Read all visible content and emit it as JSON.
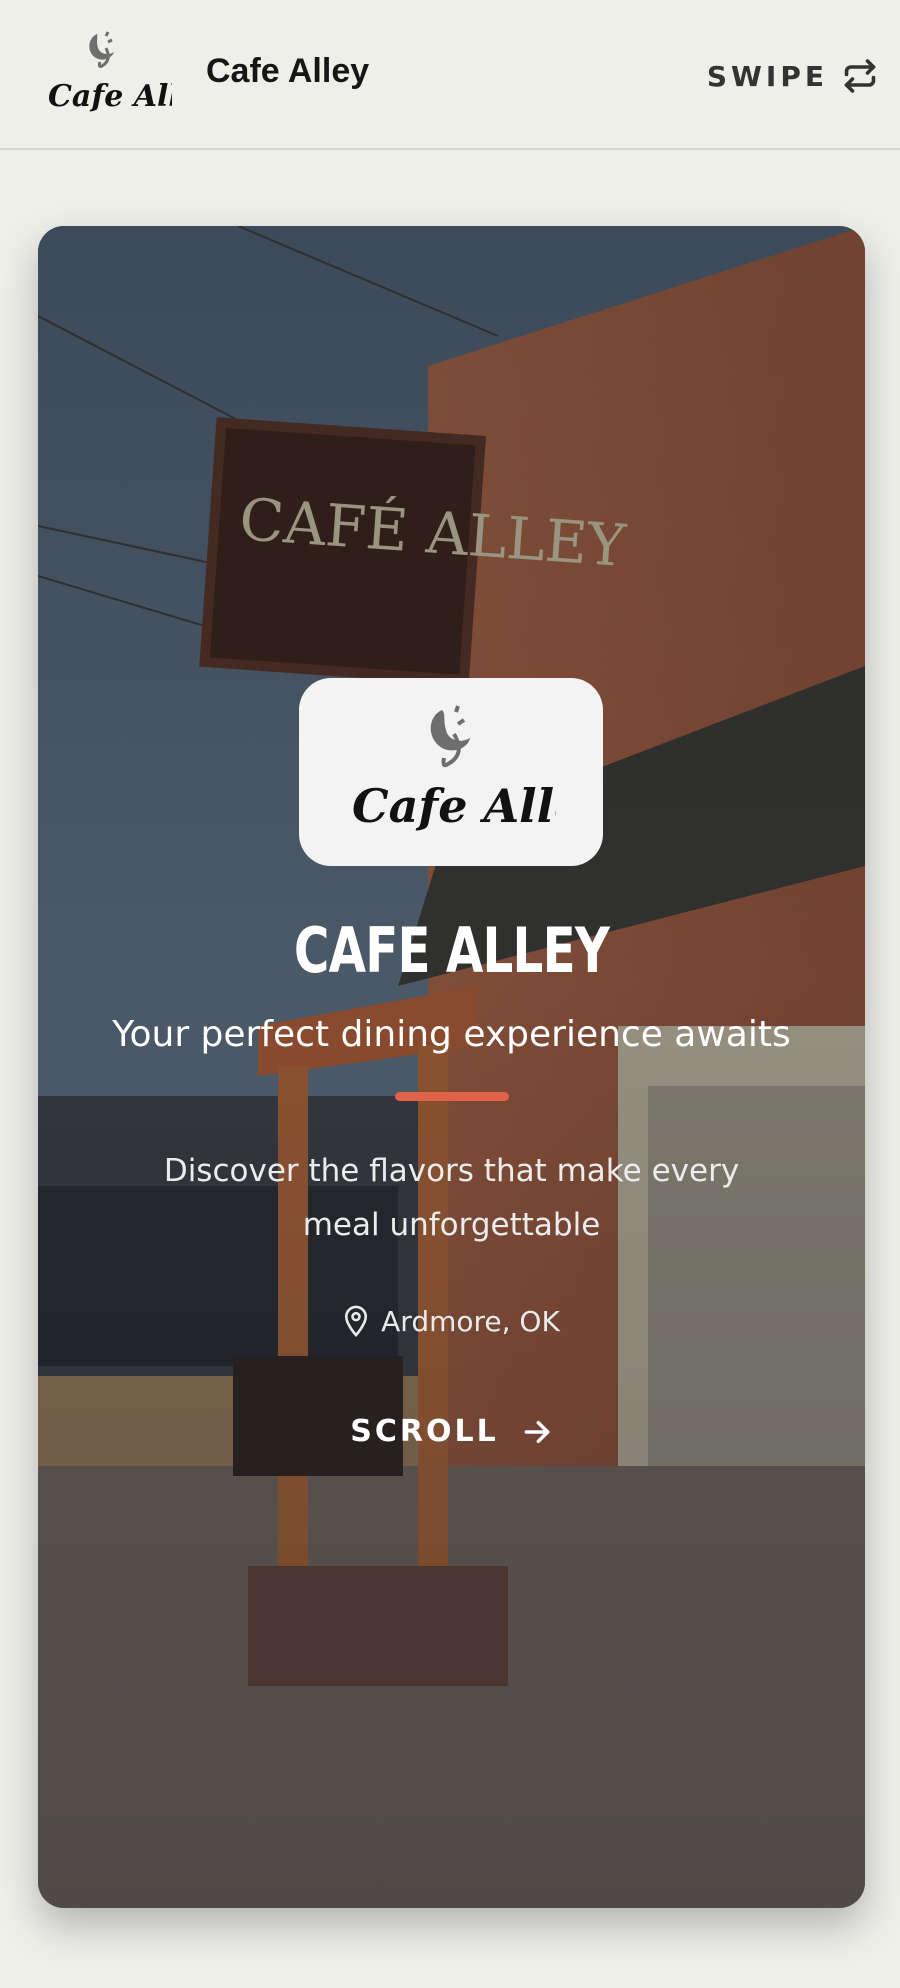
{
  "header": {
    "logo_alt": "Cafe Alley",
    "title": "Cafe Alley",
    "swipe_label": "SWIPE",
    "swipe_icon": "repeat-arrows-icon"
  },
  "hero": {
    "logo_icon": "cafe-alley-logo",
    "title": "CAFE ALLEY",
    "tagline": "Your perfect dining experience awaits",
    "description": "Discover the flavors that make every meal unforgettable",
    "location_icon": "map-pin-icon",
    "location": "Ardmore, OK",
    "scroll_label": "SCROLL",
    "scroll_icon": "arrow-right-icon"
  },
  "colors": {
    "accent": "#e0624a",
    "background": "#efefea",
    "text_dark": "#161616"
  }
}
